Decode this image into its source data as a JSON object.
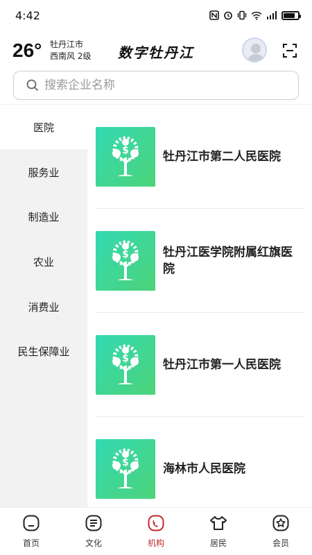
{
  "status_bar": {
    "time": "4:42",
    "signal_text": "5G"
  },
  "header": {
    "temperature": "26°",
    "city": "牡丹江市",
    "wind": "西南风  2级",
    "app_title": "数字牡丹江"
  },
  "search": {
    "placeholder": "搜索企业名称"
  },
  "sidebar": {
    "items": [
      {
        "label": "医院",
        "active": true
      },
      {
        "label": "服务业",
        "active": false
      },
      {
        "label": "制造业",
        "active": false
      },
      {
        "label": "农业",
        "active": false
      },
      {
        "label": "消费业",
        "active": false
      },
      {
        "label": "民生保障业",
        "active": false
      }
    ]
  },
  "list": {
    "items": [
      {
        "name": "牡丹江市第二人民医院",
        "icon": "money-tree-icon"
      },
      {
        "name": "牡丹江医学院附属红旗医院",
        "icon": "money-tree-icon"
      },
      {
        "name": "牡丹江市第一人民医院",
        "icon": "money-tree-icon"
      },
      {
        "name": "海林市人民医院",
        "icon": "money-tree-icon"
      }
    ]
  },
  "tabbar": {
    "tabs": [
      {
        "label": "首页",
        "icon": "home-icon",
        "active": false
      },
      {
        "label": "文化",
        "icon": "culture-icon",
        "active": false
      },
      {
        "label": "机构",
        "icon": "institution-icon",
        "active": true
      },
      {
        "label": "居民",
        "icon": "resident-icon",
        "active": false
      },
      {
        "label": "会员",
        "icon": "member-icon",
        "active": false
      }
    ]
  },
  "colors": {
    "accent_active": "#c2272d",
    "thumb_gradient_start": "#33d9b2",
    "thumb_gradient_end": "#4cd37a",
    "sidebar_bg": "#f2f2f2"
  }
}
